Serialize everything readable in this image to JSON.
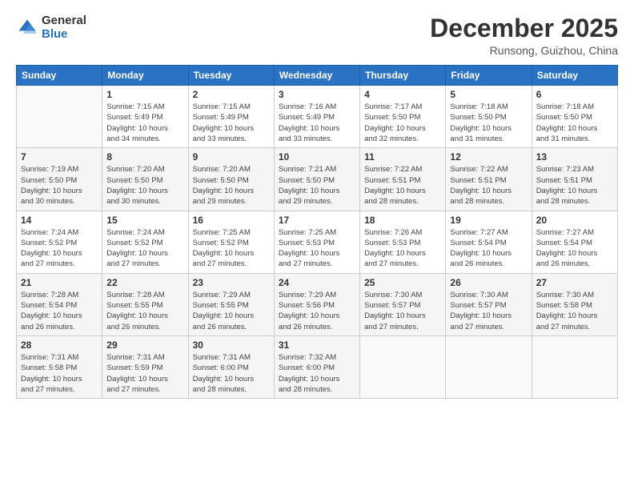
{
  "header": {
    "logo_general": "General",
    "logo_blue": "Blue",
    "month": "December 2025",
    "location": "Runsong, Guizhou, China"
  },
  "weekdays": [
    "Sunday",
    "Monday",
    "Tuesday",
    "Wednesday",
    "Thursday",
    "Friday",
    "Saturday"
  ],
  "weeks": [
    [
      {
        "day": "",
        "info": ""
      },
      {
        "day": "1",
        "info": "Sunrise: 7:15 AM\nSunset: 5:49 PM\nDaylight: 10 hours\nand 34 minutes."
      },
      {
        "day": "2",
        "info": "Sunrise: 7:15 AM\nSunset: 5:49 PM\nDaylight: 10 hours\nand 33 minutes."
      },
      {
        "day": "3",
        "info": "Sunrise: 7:16 AM\nSunset: 5:49 PM\nDaylight: 10 hours\nand 33 minutes."
      },
      {
        "day": "4",
        "info": "Sunrise: 7:17 AM\nSunset: 5:50 PM\nDaylight: 10 hours\nand 32 minutes."
      },
      {
        "day": "5",
        "info": "Sunrise: 7:18 AM\nSunset: 5:50 PM\nDaylight: 10 hours\nand 31 minutes."
      },
      {
        "day": "6",
        "info": "Sunrise: 7:18 AM\nSunset: 5:50 PM\nDaylight: 10 hours\nand 31 minutes."
      }
    ],
    [
      {
        "day": "7",
        "info": "Sunrise: 7:19 AM\nSunset: 5:50 PM\nDaylight: 10 hours\nand 30 minutes."
      },
      {
        "day": "8",
        "info": "Sunrise: 7:20 AM\nSunset: 5:50 PM\nDaylight: 10 hours\nand 30 minutes."
      },
      {
        "day": "9",
        "info": "Sunrise: 7:20 AM\nSunset: 5:50 PM\nDaylight: 10 hours\nand 29 minutes."
      },
      {
        "day": "10",
        "info": "Sunrise: 7:21 AM\nSunset: 5:50 PM\nDaylight: 10 hours\nand 29 minutes."
      },
      {
        "day": "11",
        "info": "Sunrise: 7:22 AM\nSunset: 5:51 PM\nDaylight: 10 hours\nand 28 minutes."
      },
      {
        "day": "12",
        "info": "Sunrise: 7:22 AM\nSunset: 5:51 PM\nDaylight: 10 hours\nand 28 minutes."
      },
      {
        "day": "13",
        "info": "Sunrise: 7:23 AM\nSunset: 5:51 PM\nDaylight: 10 hours\nand 28 minutes."
      }
    ],
    [
      {
        "day": "14",
        "info": "Sunrise: 7:24 AM\nSunset: 5:52 PM\nDaylight: 10 hours\nand 27 minutes."
      },
      {
        "day": "15",
        "info": "Sunrise: 7:24 AM\nSunset: 5:52 PM\nDaylight: 10 hours\nand 27 minutes."
      },
      {
        "day": "16",
        "info": "Sunrise: 7:25 AM\nSunset: 5:52 PM\nDaylight: 10 hours\nand 27 minutes."
      },
      {
        "day": "17",
        "info": "Sunrise: 7:25 AM\nSunset: 5:53 PM\nDaylight: 10 hours\nand 27 minutes."
      },
      {
        "day": "18",
        "info": "Sunrise: 7:26 AM\nSunset: 5:53 PM\nDaylight: 10 hours\nand 27 minutes."
      },
      {
        "day": "19",
        "info": "Sunrise: 7:27 AM\nSunset: 5:54 PM\nDaylight: 10 hours\nand 26 minutes."
      },
      {
        "day": "20",
        "info": "Sunrise: 7:27 AM\nSunset: 5:54 PM\nDaylight: 10 hours\nand 26 minutes."
      }
    ],
    [
      {
        "day": "21",
        "info": "Sunrise: 7:28 AM\nSunset: 5:54 PM\nDaylight: 10 hours\nand 26 minutes."
      },
      {
        "day": "22",
        "info": "Sunrise: 7:28 AM\nSunset: 5:55 PM\nDaylight: 10 hours\nand 26 minutes."
      },
      {
        "day": "23",
        "info": "Sunrise: 7:29 AM\nSunset: 5:55 PM\nDaylight: 10 hours\nand 26 minutes."
      },
      {
        "day": "24",
        "info": "Sunrise: 7:29 AM\nSunset: 5:56 PM\nDaylight: 10 hours\nand 26 minutes."
      },
      {
        "day": "25",
        "info": "Sunrise: 7:30 AM\nSunset: 5:57 PM\nDaylight: 10 hours\nand 27 minutes."
      },
      {
        "day": "26",
        "info": "Sunrise: 7:30 AM\nSunset: 5:57 PM\nDaylight: 10 hours\nand 27 minutes."
      },
      {
        "day": "27",
        "info": "Sunrise: 7:30 AM\nSunset: 5:58 PM\nDaylight: 10 hours\nand 27 minutes."
      }
    ],
    [
      {
        "day": "28",
        "info": "Sunrise: 7:31 AM\nSunset: 5:58 PM\nDaylight: 10 hours\nand 27 minutes."
      },
      {
        "day": "29",
        "info": "Sunrise: 7:31 AM\nSunset: 5:59 PM\nDaylight: 10 hours\nand 27 minutes."
      },
      {
        "day": "30",
        "info": "Sunrise: 7:31 AM\nSunset: 6:00 PM\nDaylight: 10 hours\nand 28 minutes."
      },
      {
        "day": "31",
        "info": "Sunrise: 7:32 AM\nSunset: 6:00 PM\nDaylight: 10 hours\nand 28 minutes."
      },
      {
        "day": "",
        "info": ""
      },
      {
        "day": "",
        "info": ""
      },
      {
        "day": "",
        "info": ""
      }
    ]
  ]
}
